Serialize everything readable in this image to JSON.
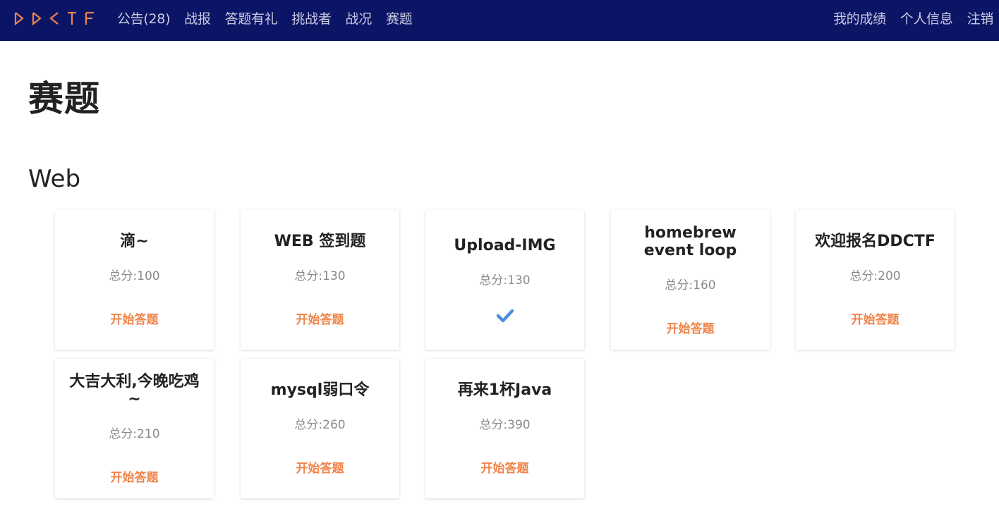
{
  "navbar": {
    "logo_text": "DDCTF",
    "brand_color": "#f0844a",
    "bg_color": "#0c1466",
    "left_links": [
      "公告(28)",
      "战报",
      "答题有礼",
      "挑战者",
      "战况",
      "赛题"
    ],
    "right_links": [
      "我的成绩",
      "个人信息",
      "注销"
    ]
  },
  "page": {
    "title": "赛题",
    "section": "Web"
  },
  "challenges": [
    {
      "name": "滴~",
      "score": "总分:100",
      "action": "开始答题",
      "solved": false
    },
    {
      "name": "WEB 签到题",
      "score": "总分:130",
      "action": "开始答题",
      "solved": false
    },
    {
      "name": "Upload-IMG",
      "score": "总分:130",
      "action": "",
      "solved": true,
      "icon": "check-icon"
    },
    {
      "name": "homebrew event loop",
      "score": "总分:160",
      "action": "开始答题",
      "solved": false
    },
    {
      "name": "欢迎报名DDCTF",
      "score": "总分:200",
      "action": "开始答题",
      "solved": false
    },
    {
      "name": "大吉大利,今晚吃鸡~",
      "score": "总分:210",
      "action": "开始答题",
      "solved": false
    },
    {
      "name": "mysql弱口令",
      "score": "总分:260",
      "action": "开始答题",
      "solved": false
    },
    {
      "name": "再来1杯Java",
      "score": "总分:390",
      "action": "开始答题",
      "solved": false
    }
  ]
}
